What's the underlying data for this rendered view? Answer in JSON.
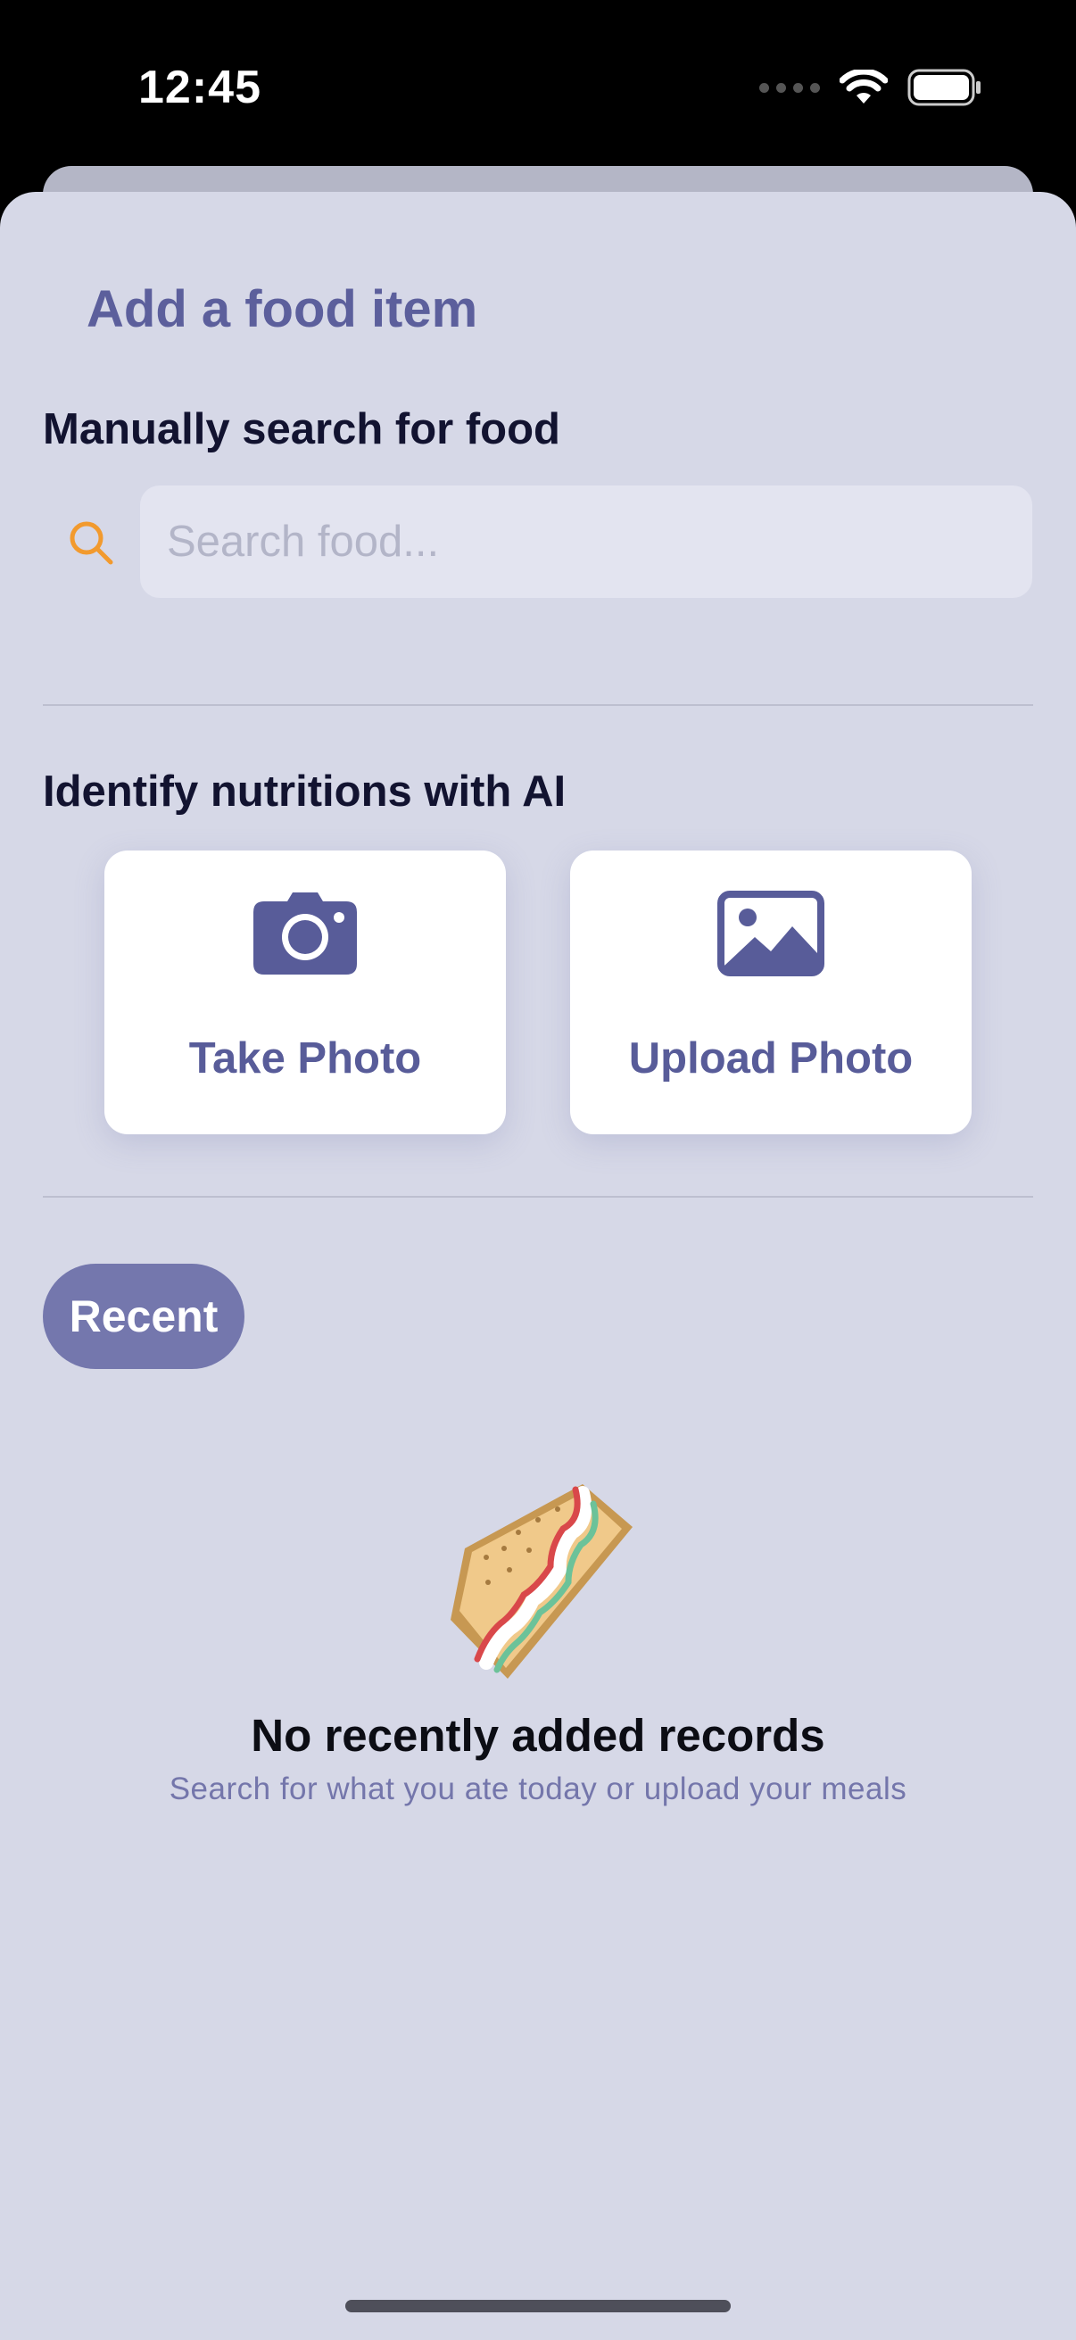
{
  "status_bar": {
    "time": "12:45"
  },
  "sheet": {
    "title": "Add a food item"
  },
  "manual_search": {
    "heading": "Manually search for food",
    "placeholder": "Search food..."
  },
  "ai_section": {
    "heading": "Identify nutritions with AI",
    "take_photo_label": "Take Photo",
    "upload_photo_label": "Upload Photo"
  },
  "recent": {
    "button_label": "Recent",
    "empty_title": "No recently added records",
    "empty_subtitle": "Search for what you ate today or upload your meals"
  },
  "icons": {
    "search": "search-icon",
    "camera": "camera-icon",
    "image": "image-icon",
    "sandwich": "sandwich-icon",
    "wifi": "wifi-icon",
    "battery": "battery-icon"
  },
  "colors": {
    "accent": "#5c5f9c",
    "search_icon": "#f29a2e",
    "recent_button": "#7477ad",
    "sheet_background": "#d6d8e7"
  }
}
